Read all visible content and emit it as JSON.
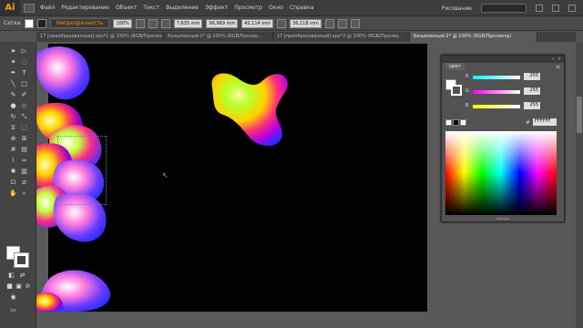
{
  "app": {
    "logo": "Ai"
  },
  "menu": [
    "Файл",
    "Редактирование",
    "Объект",
    "Текст",
    "Выделение",
    "Эффект",
    "Просмотр",
    "Окно",
    "Справка"
  ],
  "workspace": "Рисование",
  "control": {
    "type_label": "Сетка",
    "opacity_mode": "Непрозрачность",
    "opacity_value": "100%",
    "x_value": "7,635 mm",
    "y_value": "96,969 mm",
    "w_value": "42,114 mm",
    "h_value": "36,118 mm"
  },
  "tabs": [
    "17 [преобразованный].eps*1 @ 150% (RGB/Просмо...",
    "Безымянный-1* @ 100% (RGB/Просмо...",
    "17 [преобразованный].eps*2 @ 100% (RGB/Просмо...",
    "Безымянный-2* @ 100% (RGB/Просмотр)"
  ],
  "color_panel": {
    "tab": "Цвет",
    "rows": [
      {
        "label": "R",
        "value": "255",
        "color": "#00ffff"
      },
      {
        "label": "G",
        "value": "255",
        "color": "#ff00ff"
      },
      {
        "label": "B",
        "value": "255",
        "color": "#ffff00"
      }
    ],
    "hex_label": "#",
    "hex_value": "FFFFFF"
  }
}
